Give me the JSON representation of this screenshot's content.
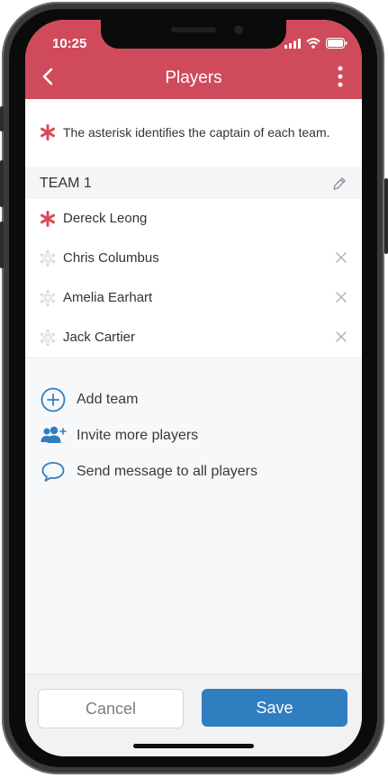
{
  "status": {
    "time": "10:25"
  },
  "header": {
    "title": "Players"
  },
  "info": {
    "text": "The asterisk identifies the captain of each team."
  },
  "team": {
    "name": "TEAM 1",
    "players": [
      {
        "name": "Dereck Leong",
        "captain": true
      },
      {
        "name": "Chris Columbus",
        "captain": false
      },
      {
        "name": "Amelia Earhart",
        "captain": false
      },
      {
        "name": "Jack Cartier",
        "captain": false
      }
    ]
  },
  "actions": {
    "add_team": "Add team",
    "invite": "Invite more players",
    "message": "Send message to all players"
  },
  "footer": {
    "cancel": "Cancel",
    "save": "Save"
  },
  "colors": {
    "header": "#cf4b5b",
    "captain_star": "#d94a57",
    "inactive_star": "#cfd2d7",
    "accent": "#2f7fc0"
  },
  "icons": {
    "back": "chevron-left-icon",
    "more": "more-vertical-icon",
    "edit": "pencil-icon",
    "remove": "close-icon",
    "add_team": "plus-circle-icon",
    "invite": "users-plus-icon",
    "message": "chat-bubble-icon"
  }
}
